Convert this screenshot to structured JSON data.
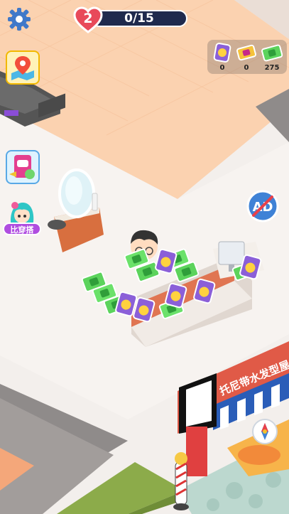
{
  "hud": {
    "level_number": "2",
    "progress_text": "0/15",
    "progress": {
      "current": 0,
      "total": 15
    }
  },
  "resources": [
    {
      "icon": "purple-cat-ticket-icon",
      "count": "0"
    },
    {
      "icon": "gold-ticket-icon",
      "count": "0"
    },
    {
      "icon": "green-cash-icon",
      "count": "275"
    }
  ],
  "side_buttons": {
    "outfit_label": "比穿搭"
  },
  "shop_sign": "托尼带水发型屋",
  "colors": {
    "accent_blue": "#3f78c9",
    "level_bar": "#1f2a4d",
    "heart_red": "#e84a5a",
    "floor_orange": "#f9c9a4"
  }
}
